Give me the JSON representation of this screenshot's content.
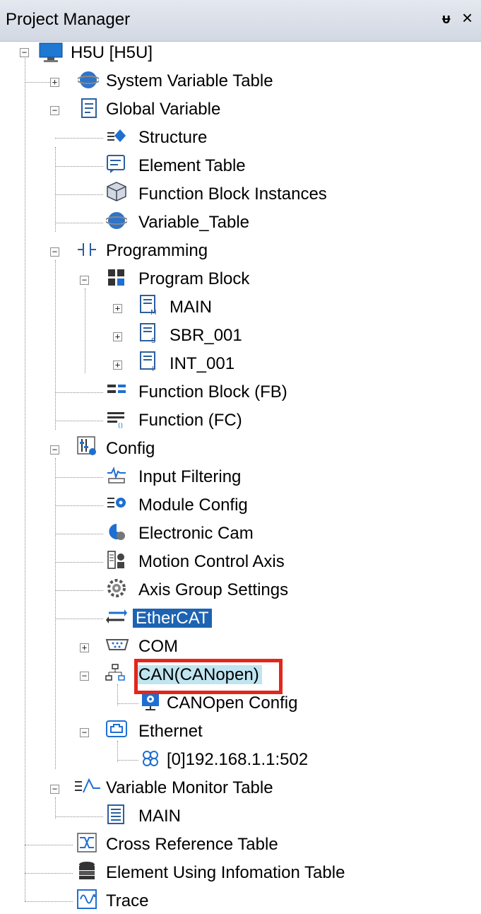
{
  "panel": {
    "title": "Project Manager",
    "pin_glyph": "ᵾ",
    "close_glyph": "×"
  },
  "tree": {
    "root": "H5U [H5U]",
    "system_variable_table": "System Variable Table",
    "global_variable": "Global Variable",
    "structure": "Structure",
    "element_table": "Element Table",
    "function_block_instances": "Function Block Instances",
    "variable_table": "Variable_Table",
    "programming": "Programming",
    "program_block": "Program Block",
    "main": "MAIN",
    "sbr_001": "SBR_001",
    "int_001": "INT_001",
    "function_block_fb": "Function Block (FB)",
    "function_fc": "Function (FC)",
    "config": "Config",
    "input_filtering": "Input Filtering",
    "module_config": "Module Config",
    "electronic_cam": "Electronic Cam",
    "motion_control_axis": "Motion Control Axis",
    "axis_group_settings": "Axis Group Settings",
    "ethercat": "EtherCAT",
    "com": "COM",
    "can": "CAN(CANopen)",
    "canopen_config": "CANOpen Config",
    "ethernet": "Ethernet",
    "ethernet_addr": "[0]192.168.1.1:502",
    "variable_monitor_table": "Variable Monitor Table",
    "monitor_main": "MAIN",
    "cross_reference_table": "Cross Reference Table",
    "element_using_info_table": "Element Using Infomation Table",
    "trace": "Trace"
  },
  "colors": {
    "selected_bg": "#1d63b2",
    "highlight_bg": "#bfe5f0",
    "annotation_box": "#e3261b"
  }
}
